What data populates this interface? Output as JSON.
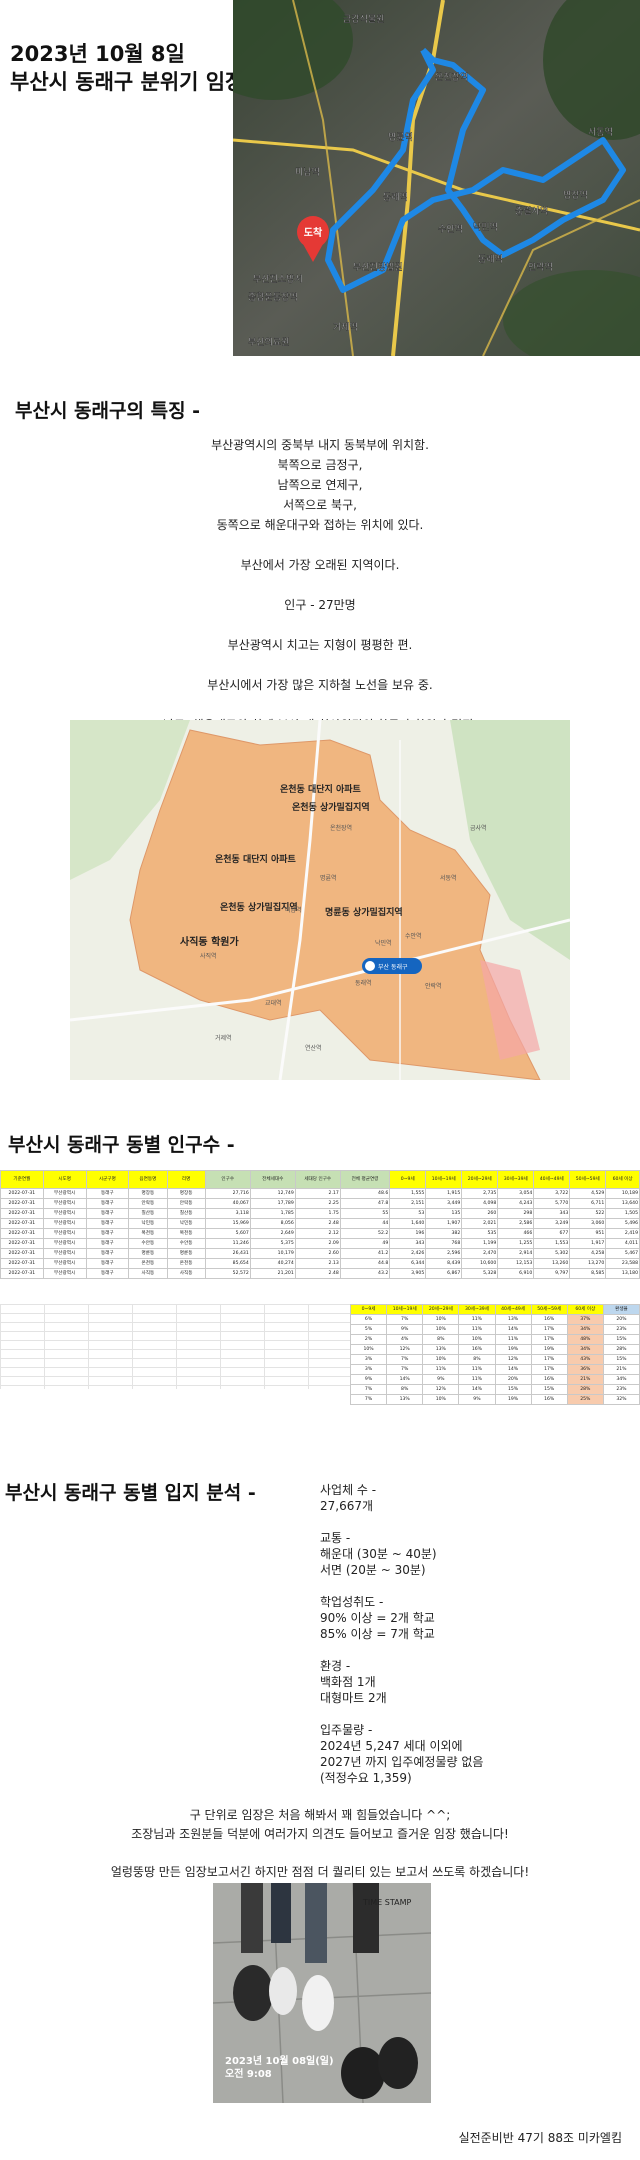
{
  "hero": {
    "title_line1": "2023년 10월 8일",
    "title_line2": "부산시 동래구 분위기 임장",
    "route_map": {
      "route_color": "#1e88e5",
      "marker_label": "도착",
      "marker_color": "#e53935",
      "place_labels": [
        "금강식물원",
        "온천장역",
        "명륜역",
        "미남역",
        "동래역",
        "수안역",
        "낙민역",
        "충렬사역",
        "명장역",
        "서동역",
        "동래역",
        "안락역",
        "부산진방법원",
        "부산진소방서",
        "종합운동장역",
        "부산의료원",
        "거제역"
      ]
    }
  },
  "features": {
    "title": "부산시 동래구의 특징 -",
    "location_lines": [
      "부산광역시의 중북부 내지 동북부에 위치함.",
      "북쪽으로 금정구,",
      "남쪽으로 연제구,",
      "서쪽으로 북구,",
      "동쪽으로 해운대구와 접하는 위치에 있다."
    ],
    "oldest": "부산에서 가장 오래된 지역이다.",
    "population": "인구 - 27만명",
    "terrain": "부산광역시 치고는 지형이 평평한 편.",
    "subway": "부산시에서 가장 많은 지하철 노선을 보유 중.",
    "school": "남구, 해운대구와 함께 부산 내 최상위권의 학군과 학원가 밀집."
  },
  "area_map": {
    "region_color": "#f2a05a",
    "labels": [
      "온천동 대단지 아파트",
      "온천동 상가밀집지역",
      "온천동 대단지 아파트",
      "온천동 상가밀집지역",
      "명륜동 상가밀집지역",
      "사직동 학원가"
    ],
    "pin_label": "부산 동래구",
    "small_labels": [
      "온천장역",
      "명륜역",
      "동래역",
      "수안역",
      "낙민역",
      "안락역",
      "교대역",
      "거제역",
      "연산역",
      "사직역",
      "금사역",
      "서동역",
      "미남역"
    ]
  },
  "population": {
    "title": "부산시 동래구 동별 인구수 -",
    "headers": [
      "기준연월",
      "시도명",
      "시군구명",
      "읍면동명",
      "리명",
      "인구수",
      "전체세대수",
      "세대당 인구수",
      "전체 평균연령",
      "0~9세",
      "10세~19세",
      "20세~29세",
      "30세~39세",
      "40세~49세",
      "50세~59세",
      "60세 이상"
    ],
    "rows": [
      [
        "2022-07-31",
        "부산광역시",
        "동래구",
        "명장동",
        "명장동",
        "27,716",
        "12,749",
        "2.17",
        "48.6",
        "1,555",
        "1,915",
        "2,735",
        "3,054",
        "3,722",
        "4,529",
        "10,189"
      ],
      [
        "2022-07-31",
        "부산광역시",
        "동래구",
        "안락동",
        "안락동",
        "40,067",
        "17,789",
        "2.25",
        "47.8",
        "2,151",
        "3,449",
        "4,098",
        "4,243",
        "5,770",
        "6,711",
        "13,640"
      ],
      [
        "2022-07-31",
        "부산광역시",
        "동래구",
        "칠산동",
        "칠산동",
        "3,118",
        "1,785",
        "1.75",
        "55",
        "53",
        "135",
        "260",
        "298",
        "343",
        "522",
        "1,505"
      ],
      [
        "2022-07-31",
        "부산광역시",
        "동래구",
        "낙민동",
        "낙민동",
        "15,969",
        "8,056",
        "2.48",
        "44",
        "1,640",
        "1,907",
        "2,021",
        "2,586",
        "3,249",
        "3,060",
        "5,496"
      ],
      [
        "2022-07-31",
        "부산광역시",
        "동래구",
        "복천동",
        "복천동",
        "5,607",
        "2,649",
        "2.12",
        "52.2",
        "196",
        "382",
        "535",
        "466",
        "677",
        "951",
        "2,419"
      ],
      [
        "2022-07-31",
        "부산광역시",
        "동래구",
        "수안동",
        "수안동",
        "11,246",
        "5,375",
        "2.09",
        "49",
        "343",
        "768",
        "1,199",
        "1,255",
        "1,553",
        "1,917",
        "4,011"
      ],
      [
        "2022-07-31",
        "부산광역시",
        "동래구",
        "명륜동",
        "명륜동",
        "26,431",
        "10,179",
        "2.60",
        "41.2",
        "2,426",
        "2,596",
        "2,470",
        "2,914",
        "5,302",
        "4,258",
        "5,467"
      ],
      [
        "2022-07-31",
        "부산광역시",
        "동래구",
        "온천동",
        "온천동",
        "85,654",
        "40,274",
        "2.13",
        "44.8",
        "6,344",
        "8,439",
        "10,600",
        "12,153",
        "13,260",
        "13,270",
        "23,588"
      ],
      [
        "2022-07-31",
        "부산광역시",
        "동래구",
        "사직동",
        "사직동",
        "52,572",
        "21,201",
        "2.48",
        "43.2",
        "3,905",
        "6,867",
        "5,328",
        "6,910",
        "9,797",
        "8,585",
        "13,180"
      ]
    ],
    "ratio_headers": [
      "0~9세",
      "10세~19세",
      "20세~29세",
      "30세~39세",
      "40세~49세",
      "50세~59세",
      "60세 이상",
      "환생율"
    ],
    "ratio_rows": [
      [
        "6%",
        "7%",
        "10%",
        "11%",
        "13%",
        "16%",
        "37%",
        "20%"
      ],
      [
        "5%",
        "9%",
        "10%",
        "11%",
        "14%",
        "17%",
        "34%",
        "23%"
      ],
      [
        "2%",
        "4%",
        "8%",
        "10%",
        "11%",
        "17%",
        "48%",
        "15%"
      ],
      [
        "10%",
        "12%",
        "13%",
        "16%",
        "19%",
        "19%",
        "34%",
        "28%"
      ],
      [
        "3%",
        "7%",
        "10%",
        "8%",
        "12%",
        "17%",
        "43%",
        "15%"
      ],
      [
        "3%",
        "7%",
        "11%",
        "11%",
        "14%",
        "17%",
        "36%",
        "21%"
      ],
      [
        "9%",
        "14%",
        "9%",
        "11%",
        "20%",
        "16%",
        "21%",
        "34%"
      ],
      [
        "7%",
        "8%",
        "12%",
        "14%",
        "15%",
        "15%",
        "28%",
        "23%"
      ],
      [
        "7%",
        "13%",
        "10%",
        "9%",
        "19%",
        "16%",
        "25%",
        "32%"
      ]
    ]
  },
  "analysis": {
    "title": "부산시 동래구 동별 입지 분석 -",
    "business_label": "사업체 수 -",
    "business_value": "27,667개",
    "transport_label": "교통 -",
    "transport_1": "해운대 (30분 ~ 40분)",
    "transport_2": "서면 (20분 ~ 30분)",
    "school_label": "학업성취도 -",
    "school_1": "90% 이상 = 2개 학교",
    "school_2": "85% 이상 = 7개 학교",
    "env_label": "환경 -",
    "env_1": "백화점 1개",
    "env_2": "대형마트 2개",
    "supply_label": "입주물량 -",
    "supply_1": "2024년 5,247 세대 이외에",
    "supply_2": "2027년 까지 입주예정물량 없음",
    "supply_3": "(적정수요 1,359)"
  },
  "closing": {
    "line1": "구 단위로 임장은 처음 해봐서 꽤 힘들었습니다 ^^;",
    "line2": "조장님과 조원분들 덕분에 여러가지 의견도 들어보고 즐거운 임장 했습니다!",
    "line3": "얼렁뚱땅 만든 임장보고서긴 하지만 점점 더 퀄리티 있는 보고서 쓰도록 하겠습니다!"
  },
  "photo": {
    "stamp_date": "2023년 10월 08일(일)",
    "stamp_time": "오전 9:08",
    "watermark": "TIME STAMP"
  },
  "signature": "실전준비반 47기 88조 미카엘킴"
}
